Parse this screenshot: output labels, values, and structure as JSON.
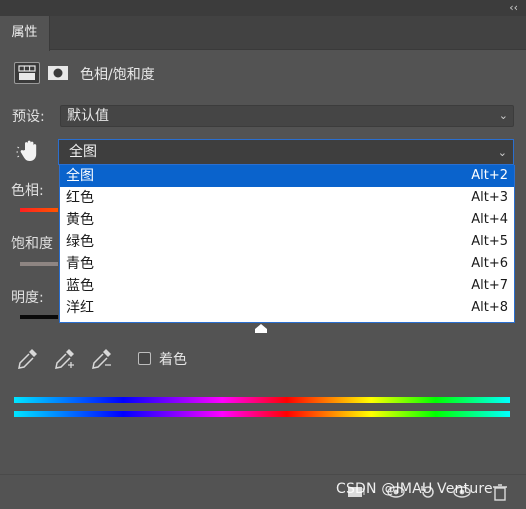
{
  "panel": {
    "tab_label": "属性",
    "title": "色相/饱和度",
    "collapse_glyph": "‹‹"
  },
  "preset": {
    "label": "预设:",
    "value": "默认值"
  },
  "channel": {
    "value": "全图",
    "options": [
      {
        "label": "全图",
        "shortcut": "Alt+2",
        "selected": true
      },
      {
        "label": "红色",
        "shortcut": "Alt+3"
      },
      {
        "label": "黄色",
        "shortcut": "Alt+4"
      },
      {
        "label": "绿色",
        "shortcut": "Alt+5"
      },
      {
        "label": "青色",
        "shortcut": "Alt+6"
      },
      {
        "label": "蓝色",
        "shortcut": "Alt+7"
      },
      {
        "label": "洋红",
        "shortcut": "Alt+8"
      }
    ]
  },
  "sliders": {
    "hue_label": "色相:",
    "saturation_label": "饱和度",
    "lightness_label": "明度:"
  },
  "colorize": {
    "label": "着色",
    "checked": false
  },
  "watermark": "CSDN @IMAU Venture",
  "colors": {
    "panel_bg": "#535353",
    "accent": "#0a63cc",
    "border_focus": "#2a6fd0"
  }
}
